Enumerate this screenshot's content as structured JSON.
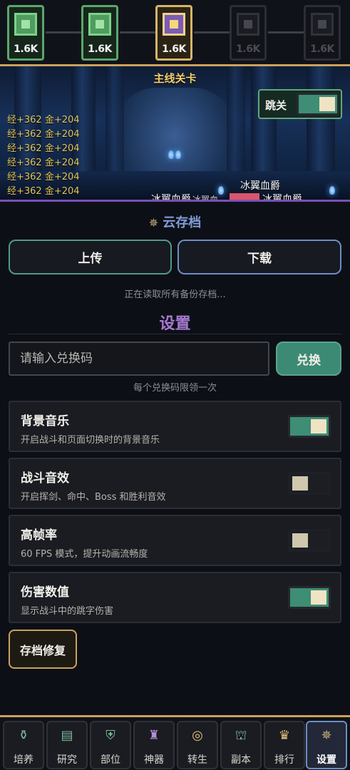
{
  "stages": [
    {
      "cost": "1.6K",
      "state": "cleared"
    },
    {
      "cost": "1.6K",
      "state": "cleared"
    },
    {
      "cost": "1.6K",
      "state": "current"
    },
    {
      "cost": "1.6K",
      "state": "locked"
    },
    {
      "cost": "1.6K",
      "state": "locked"
    }
  ],
  "scene": {
    "title": "主线关卡",
    "skip_label": "跳关",
    "skip_on": true,
    "log": [
      "经+362 金+204",
      "经+362 金+204",
      "经+362 金+204",
      "经+362 金+204",
      "经+362 金+204",
      "经+362 金+204"
    ],
    "enemy_name_top": "冰翼血爵",
    "enemy_name_left": "冰翼血爵",
    "enemy_name_right": "冰翼血爵",
    "enemy_name_mid": "冰翼血"
  },
  "cloud": {
    "title": "云存档",
    "upload": "上传",
    "download": "下载",
    "status": "正在读取所有备份存档..."
  },
  "settings": {
    "title": "设置",
    "code_placeholder": "请输入兑换码",
    "redeem": "兑换",
    "redeem_hint": "每个兑换码限领一次",
    "rows": [
      {
        "title": "背景音乐",
        "desc": "开启战斗和页面切换时的背景音乐",
        "on": true
      },
      {
        "title": "战斗音效",
        "desc": "开启挥剑、命中、Boss 和胜利音效",
        "on": false
      },
      {
        "title": "高帧率",
        "desc": "60 FPS 模式，提升动画流畅度",
        "on": false
      },
      {
        "title": "伤害数值",
        "desc": "显示战斗中的跳字伤害",
        "on": true
      }
    ],
    "repair": "存档修复"
  },
  "nav": [
    {
      "label": "培养",
      "icon": "flask-icon"
    },
    {
      "label": "研究",
      "icon": "book-icon"
    },
    {
      "label": "部位",
      "icon": "armor-icon"
    },
    {
      "label": "神器",
      "icon": "artifact-icon"
    },
    {
      "label": "转生",
      "icon": "compass-icon"
    },
    {
      "label": "副本",
      "icon": "dungeon-icon"
    },
    {
      "label": "排行",
      "icon": "crown-icon"
    },
    {
      "label": "设置",
      "icon": "gear-icon",
      "active": true
    }
  ],
  "colors": {
    "accent_gold": "#caa25b",
    "accent_green": "#3d8e74",
    "accent_purple": "#a67ad0",
    "accent_blue": "#6c8ec7"
  }
}
